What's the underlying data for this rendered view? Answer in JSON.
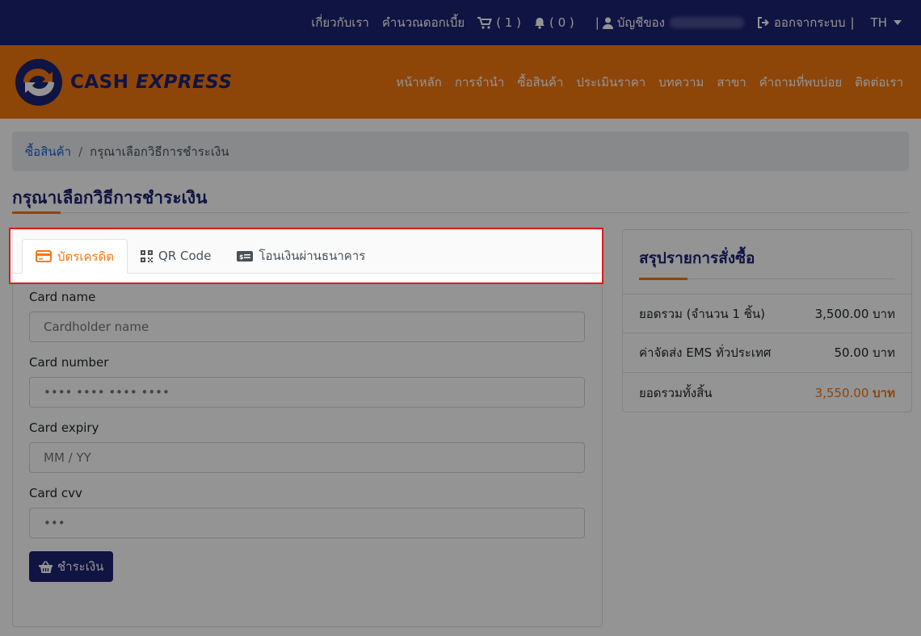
{
  "topbar": {
    "about": "เกี่ยวกับเรา",
    "calculator": "คำนวณดอกเบี้ย",
    "cart_count": "( 1 )",
    "notify_count": "( 0 )",
    "account_label": "บัญชีของ",
    "logout": "ออกจากระบบ",
    "lang": "TH"
  },
  "brand": {
    "cash": "CASH",
    "express": "EXPRESS"
  },
  "nav": [
    "หน้าหลัก",
    "การจำนำ",
    "ซื้อสินค้า",
    "ประเมินราคา",
    "บทความ",
    "สาขา",
    "คำถามที่พบบ่อย",
    "ติดต่อเรา"
  ],
  "breadcrumb": {
    "parent": "ซื้อสินค้า",
    "current": "กรุณาเลือกวิธีการชำระเงิน"
  },
  "page_title": "กรุณาเลือกวิธีการชำระเงิน",
  "tabs": [
    {
      "label": "บัตรเครดิต",
      "icon": "credit-card-icon",
      "active": true
    },
    {
      "label": "QR Code",
      "icon": "qrcode-icon",
      "active": false
    },
    {
      "label": "โอนเงินผ่านธนาคาร",
      "icon": "money-transfer-icon",
      "active": false
    }
  ],
  "form": {
    "card_name": {
      "label": "Card name",
      "placeholder": "Cardholder name"
    },
    "card_number": {
      "label": "Card number",
      "placeholder": "•••• •••• •••• ••••"
    },
    "card_expiry": {
      "label": "Card expiry",
      "placeholder": "MM / YY"
    },
    "card_cvv": {
      "label": "Card cvv",
      "placeholder": "•••"
    },
    "pay_button": "ชำระเงิน"
  },
  "summary": {
    "title": "สรุปรายการสั่งซื้อ",
    "rows": [
      {
        "label": "ยอดรวม (จำนวน 1 ชิ้น)",
        "value": "3,500.00 บาท"
      },
      {
        "label": "ค่าจัดส่ง EMS ทั่วประเทศ",
        "value": "50.00 บาท"
      },
      {
        "label": "ยอดรวมทั้งสิ้น",
        "amount": "3,550.00",
        "unit": "บาท"
      }
    ]
  },
  "colors": {
    "navy": "#1d2373",
    "orange": "#f5770f",
    "highlight": "#e0181c"
  }
}
